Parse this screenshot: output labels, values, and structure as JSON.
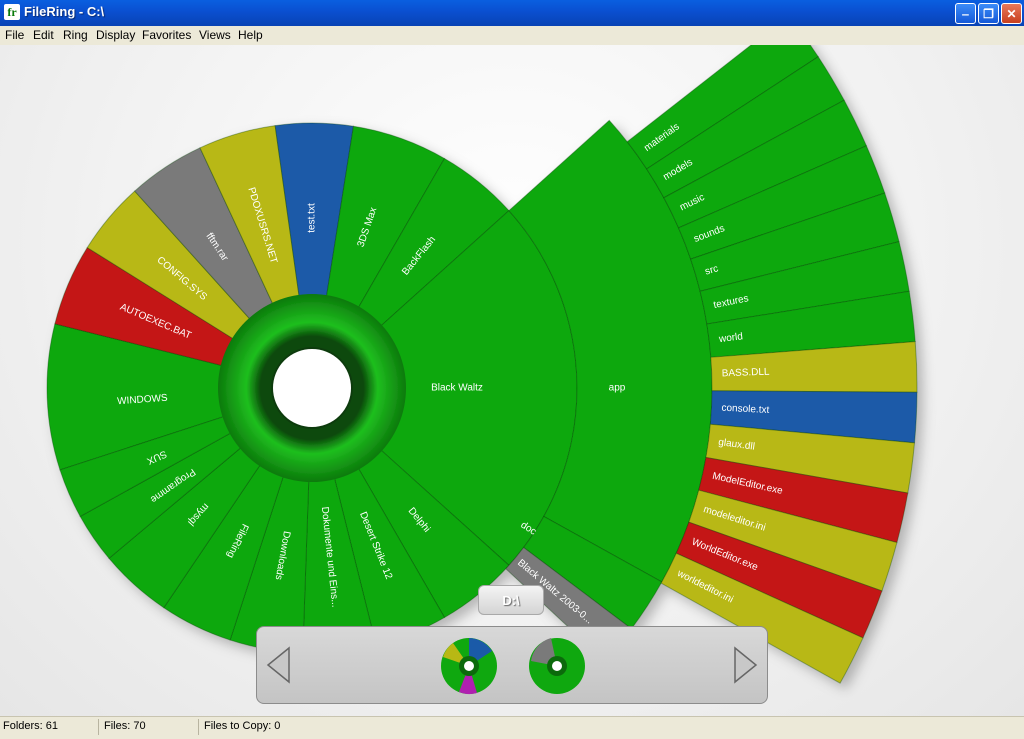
{
  "window": {
    "title": "FileRing - C:\\",
    "app_icon": "fr"
  },
  "menu": [
    "File",
    "Edit",
    "Ring",
    "Display",
    "Favorites",
    "Views",
    "Help"
  ],
  "colors": {
    "folder": "#0fa80f",
    "yellow": "#b8b814",
    "gray": "#7a7a7a",
    "blue": "#1a5aa8",
    "red": "#c41414"
  },
  "ring": {
    "outer_labels": [
      "WINDOWS",
      "AUTOEXEC.BAT",
      "CONFIG.SYS",
      "fftm.rar",
      "PDOXUSRS.NET",
      "test.txt",
      "3DS Max",
      "BackFlash",
      "Black Waltz",
      "Delphi",
      "Desert Strike 12",
      "Dokumente und Eins...",
      "Downloads",
      "FileRing",
      "mysql",
      "Programme",
      "SUX"
    ],
    "mid_labels": [
      "app",
      "doc",
      "Black Waltz 2003-0..."
    ],
    "app_items": [
      "materials",
      "models",
      "music",
      "sounds",
      "src",
      "textures",
      "world",
      "BASS.DLL",
      "console.txt",
      "glaux.dll",
      "ModelEditor.exe",
      "modeleditor.ini",
      "WorldEditor.exe",
      "worldeditor.ini"
    ]
  },
  "drive_label": "D:\\",
  "status": {
    "folders": "Folders: 61",
    "files": "Files: 70",
    "copy": "Files to Copy: 0"
  }
}
